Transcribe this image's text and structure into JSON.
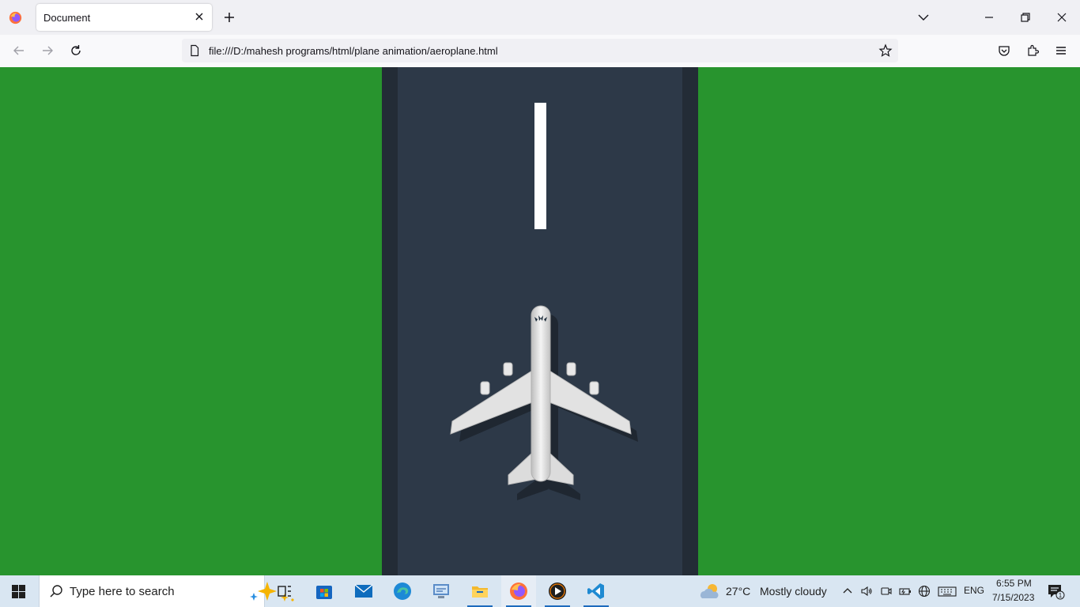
{
  "browser": {
    "tab": {
      "title": "Document"
    },
    "url": "file:///D:/mahesh programs/html/plane animation/aeroplane.html"
  },
  "page": {
    "colors": {
      "grass": "#28942e",
      "runway": "#2d3948",
      "runway_edge": "#232c36",
      "center_line": "#ffffff"
    }
  },
  "taskbar": {
    "search_placeholder": "Type here to search",
    "apps": [
      "task-view",
      "microsoft-store",
      "mail",
      "edge",
      "control-panel",
      "file-explorer",
      "firefox",
      "media-player",
      "vscode"
    ],
    "weather": {
      "temp": "27°C",
      "condition": "Mostly cloudy"
    },
    "language": "ENG",
    "time": "6:55 PM",
    "date": "7/15/2023",
    "notification_count": "1"
  }
}
